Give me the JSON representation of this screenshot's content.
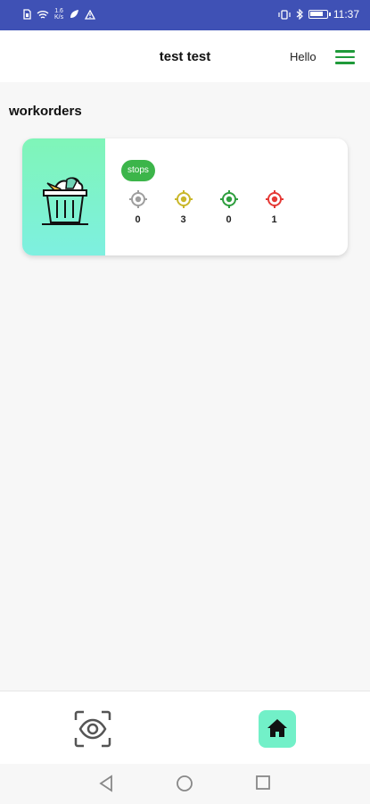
{
  "status_bar": {
    "speed": [
      "1.6",
      "K/s"
    ],
    "time": "11:37",
    "icons_left": [
      "sim-icon",
      "wifi-icon",
      "leaf-icon",
      "warning-icon"
    ],
    "icons_right": [
      "vibrate-icon",
      "bluetooth-icon",
      "battery-icon"
    ]
  },
  "header": {
    "title": "test test",
    "greeting": "Hello",
    "menu_icon": "hamburger-menu-icon"
  },
  "main": {
    "section_title": "workorders",
    "workorders": [
      {
        "thumbnail_icon": "trash-basket-icon",
        "badge": "stops",
        "counts": [
          {
            "icon": "gray-target-icon",
            "color": "#9e9e9e",
            "value": "0"
          },
          {
            "icon": "yellow-target-icon",
            "color": "#c9b72a",
            "value": "3"
          },
          {
            "icon": "green-target-icon",
            "color": "#2e9e3e",
            "value": "0"
          },
          {
            "icon": "red-target-icon",
            "color": "#e53935",
            "value": "1"
          }
        ]
      }
    ]
  },
  "bottom_nav": {
    "items": [
      {
        "icon": "eye-scan-icon"
      },
      {
        "icon": "home-icon"
      }
    ]
  },
  "colors": {
    "status_bar": "#3f51b5",
    "accent_green": "#1f9a3a",
    "badge_green": "#3cb54a",
    "mint": "#72f0c8"
  }
}
